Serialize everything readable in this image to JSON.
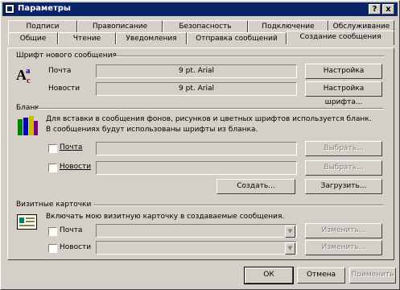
{
  "window": {
    "title": "Параметры",
    "help_btn": "?",
    "close_btn": "x"
  },
  "tabs_back": [
    "Подписи",
    "Правописание",
    "Безопасность",
    "Подключение",
    "Обслуживание"
  ],
  "tabs_front": [
    "Общие",
    "Чтение",
    "Уведомления",
    "Отправка сообщений",
    "Создание сообщения"
  ],
  "font_group": {
    "title": "Шрифт нового сообщения",
    "mail_label": "Почта",
    "mail_value": "9 pt. Arial",
    "news_label": "Новости",
    "news_value": "9 pt. Arial",
    "settings_button": "Настройка шрифта..."
  },
  "stationery_group": {
    "title": "Бланк",
    "description_line1": "Для вставки в сообщения фонов, рисунков и цветных шрифтов используется бланк.",
    "description_line2": "В сообщениях будут использованы шрифты из бланка.",
    "mail_label": "Почта",
    "news_label": "Новости",
    "select_button": "Выбрать...",
    "create_button": "Создать...",
    "download_button": "Загрузить..."
  },
  "vcard_group": {
    "title": "Визитные карточки",
    "description": "Включать мою визитную карточку в создаваемые сообщения.",
    "mail_label": "Почта",
    "news_label": "Новости",
    "edit_button": "Изменить..."
  },
  "footer": {
    "ok": "ОК",
    "cancel": "Отмена",
    "apply": "Применить"
  }
}
